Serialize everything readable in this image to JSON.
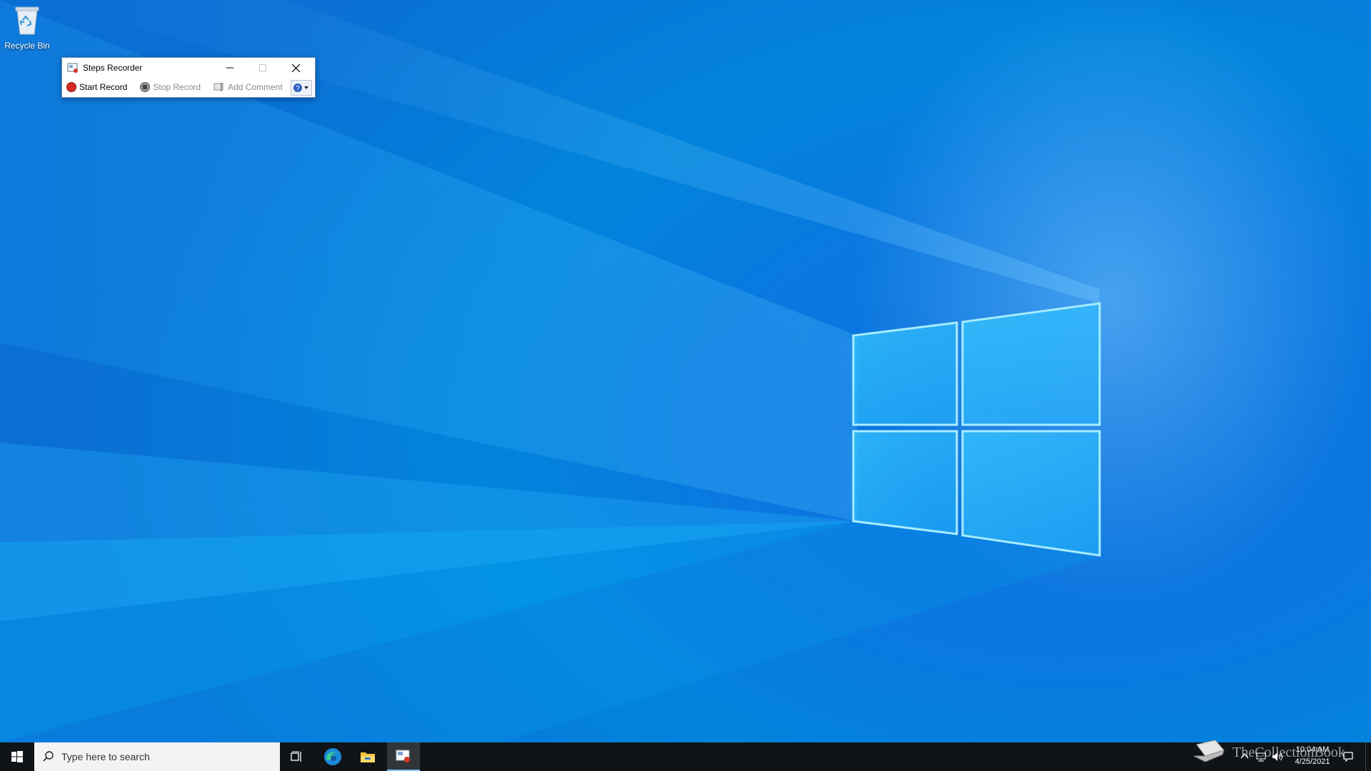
{
  "desktop": {
    "icons": [
      {
        "label": "Recycle Bin",
        "icon": "recycle-bin-icon"
      }
    ],
    "wallpaper": "windows-10-hero",
    "accent": "#0a78e0"
  },
  "steps_recorder": {
    "title": "Steps Recorder",
    "app_icon": "steps-recorder-icon",
    "toolbar": {
      "start_record": "Start Record",
      "stop_record": "Stop Record",
      "add_comment": "Add Comment",
      "help": "help-icon"
    },
    "window_buttons": [
      "minimize-icon",
      "maximize-icon",
      "close-icon"
    ]
  },
  "taskbar": {
    "search_placeholder": "Type here to search",
    "apps": [
      "task-view-icon",
      "edge-icon",
      "file-explorer-icon",
      "steps-recorder-icon"
    ],
    "tray": {
      "time": "10:04 AM",
      "date": "4/25/2021"
    }
  },
  "watermark": {
    "text": "TheCollectionBook"
  }
}
